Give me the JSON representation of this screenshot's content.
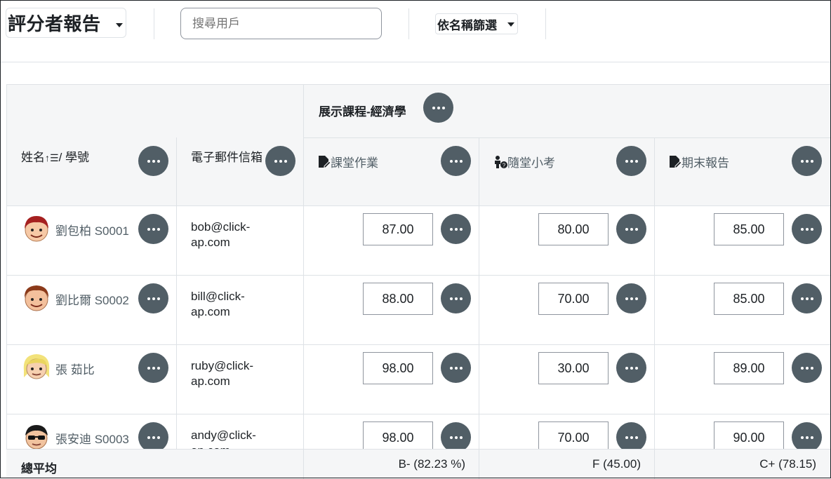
{
  "header": {
    "report_title": "評分者報告",
    "search_placeholder": "搜尋用戶",
    "filter_label": "依名稱篩選"
  },
  "course": {
    "name": "展示課程-經濟學"
  },
  "columns": {
    "name": "姓名",
    "id_suffix": "/ 學號",
    "email": "電子郵件信箱",
    "items": [
      {
        "label": "課堂作業",
        "icon": "assignment-icon"
      },
      {
        "label": "隨堂小考",
        "icon": "quiz-icon"
      },
      {
        "label": "期末報告",
        "icon": "assignment-icon"
      }
    ]
  },
  "students": [
    {
      "name": "劉包柏 S0001",
      "email_1": "bob@click-",
      "email_2": "ap.com",
      "grades": [
        "87.00",
        "80.00",
        "85.00"
      ],
      "avatar": "avatar-red-hair"
    },
    {
      "name": "劉比爾 S0002",
      "email_1": "bill@click-",
      "email_2": "ap.com",
      "grades": [
        "88.00",
        "70.00",
        "85.00"
      ],
      "avatar": "avatar-brown-hair"
    },
    {
      "name": "張 茹比",
      "email_1": "ruby@click-",
      "email_2": "ap.com",
      "grades": [
        "98.00",
        "30.00",
        "89.00"
      ],
      "avatar": "avatar-blonde-hair"
    },
    {
      "name": "張安迪 S0003",
      "email_1": "andy@click-",
      "email_2": "ap.com",
      "grades": [
        "98.00",
        "70.00",
        "90.00"
      ],
      "avatar": "avatar-glasses"
    }
  ],
  "footer": {
    "label": "總平均",
    "averages": [
      "B- (82.23 %)",
      "F (45.00)",
      "C+ (78.15)"
    ]
  },
  "colors": {
    "action_button": "#515e66",
    "border": "#dee2e6",
    "header_bg": "#f5f6f7"
  }
}
